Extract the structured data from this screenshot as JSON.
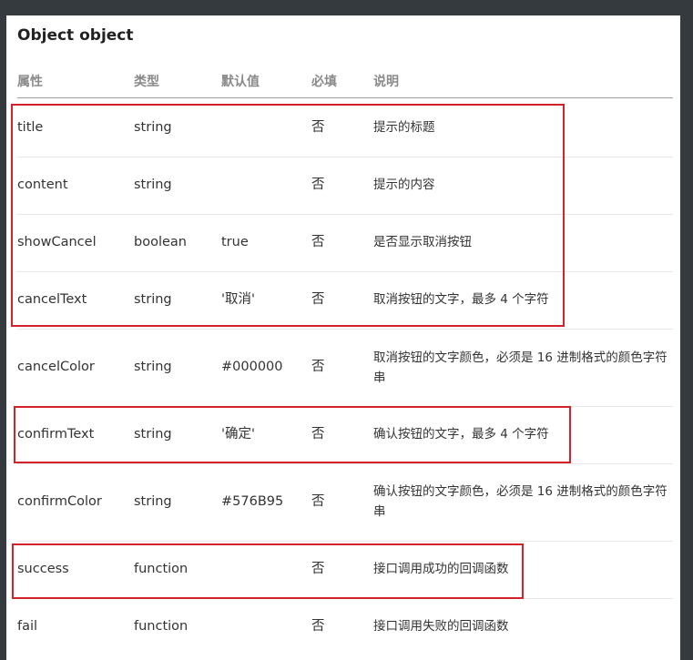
{
  "section": {
    "title": "Object object"
  },
  "columns": [
    "属性",
    "类型",
    "默认值",
    "必填",
    "说明"
  ],
  "rows": [
    {
      "name": "title",
      "type": "string",
      "default": "",
      "required": "否",
      "description": "提示的标题"
    },
    {
      "name": "content",
      "type": "string",
      "default": "",
      "required": "否",
      "description": "提示的内容"
    },
    {
      "name": "showCancel",
      "type": "boolean",
      "default": "true",
      "required": "否",
      "description": "是否显示取消按钮"
    },
    {
      "name": "cancelText",
      "type": "string",
      "default": "'取消'",
      "required": "否",
      "description": "取消按钮的文字，最多 4 个字符"
    },
    {
      "name": "cancelColor",
      "type": "string",
      "default": "#000000",
      "required": "否",
      "description": "取消按钮的文字颜色，必须是 16 进制格式的颜色字符串"
    },
    {
      "name": "confirmText",
      "type": "string",
      "default": "'确定'",
      "required": "否",
      "description": "确认按钮的文字，最多 4 个字符"
    },
    {
      "name": "confirmColor",
      "type": "string",
      "default": "#576B95",
      "required": "否",
      "description": "确认按钮的文字颜色，必须是 16 进制格式的颜色字符串"
    },
    {
      "name": "success",
      "type": "function",
      "default": "",
      "required": "否",
      "description": "接口调用成功的回调函数"
    },
    {
      "name": "fail",
      "type": "function",
      "default": "",
      "required": "否",
      "description": "接口调用失败的回调函数"
    }
  ],
  "colors": {
    "background": "#353a3e",
    "highlight": "#d2232a",
    "header_text": "#8a8a8a"
  }
}
